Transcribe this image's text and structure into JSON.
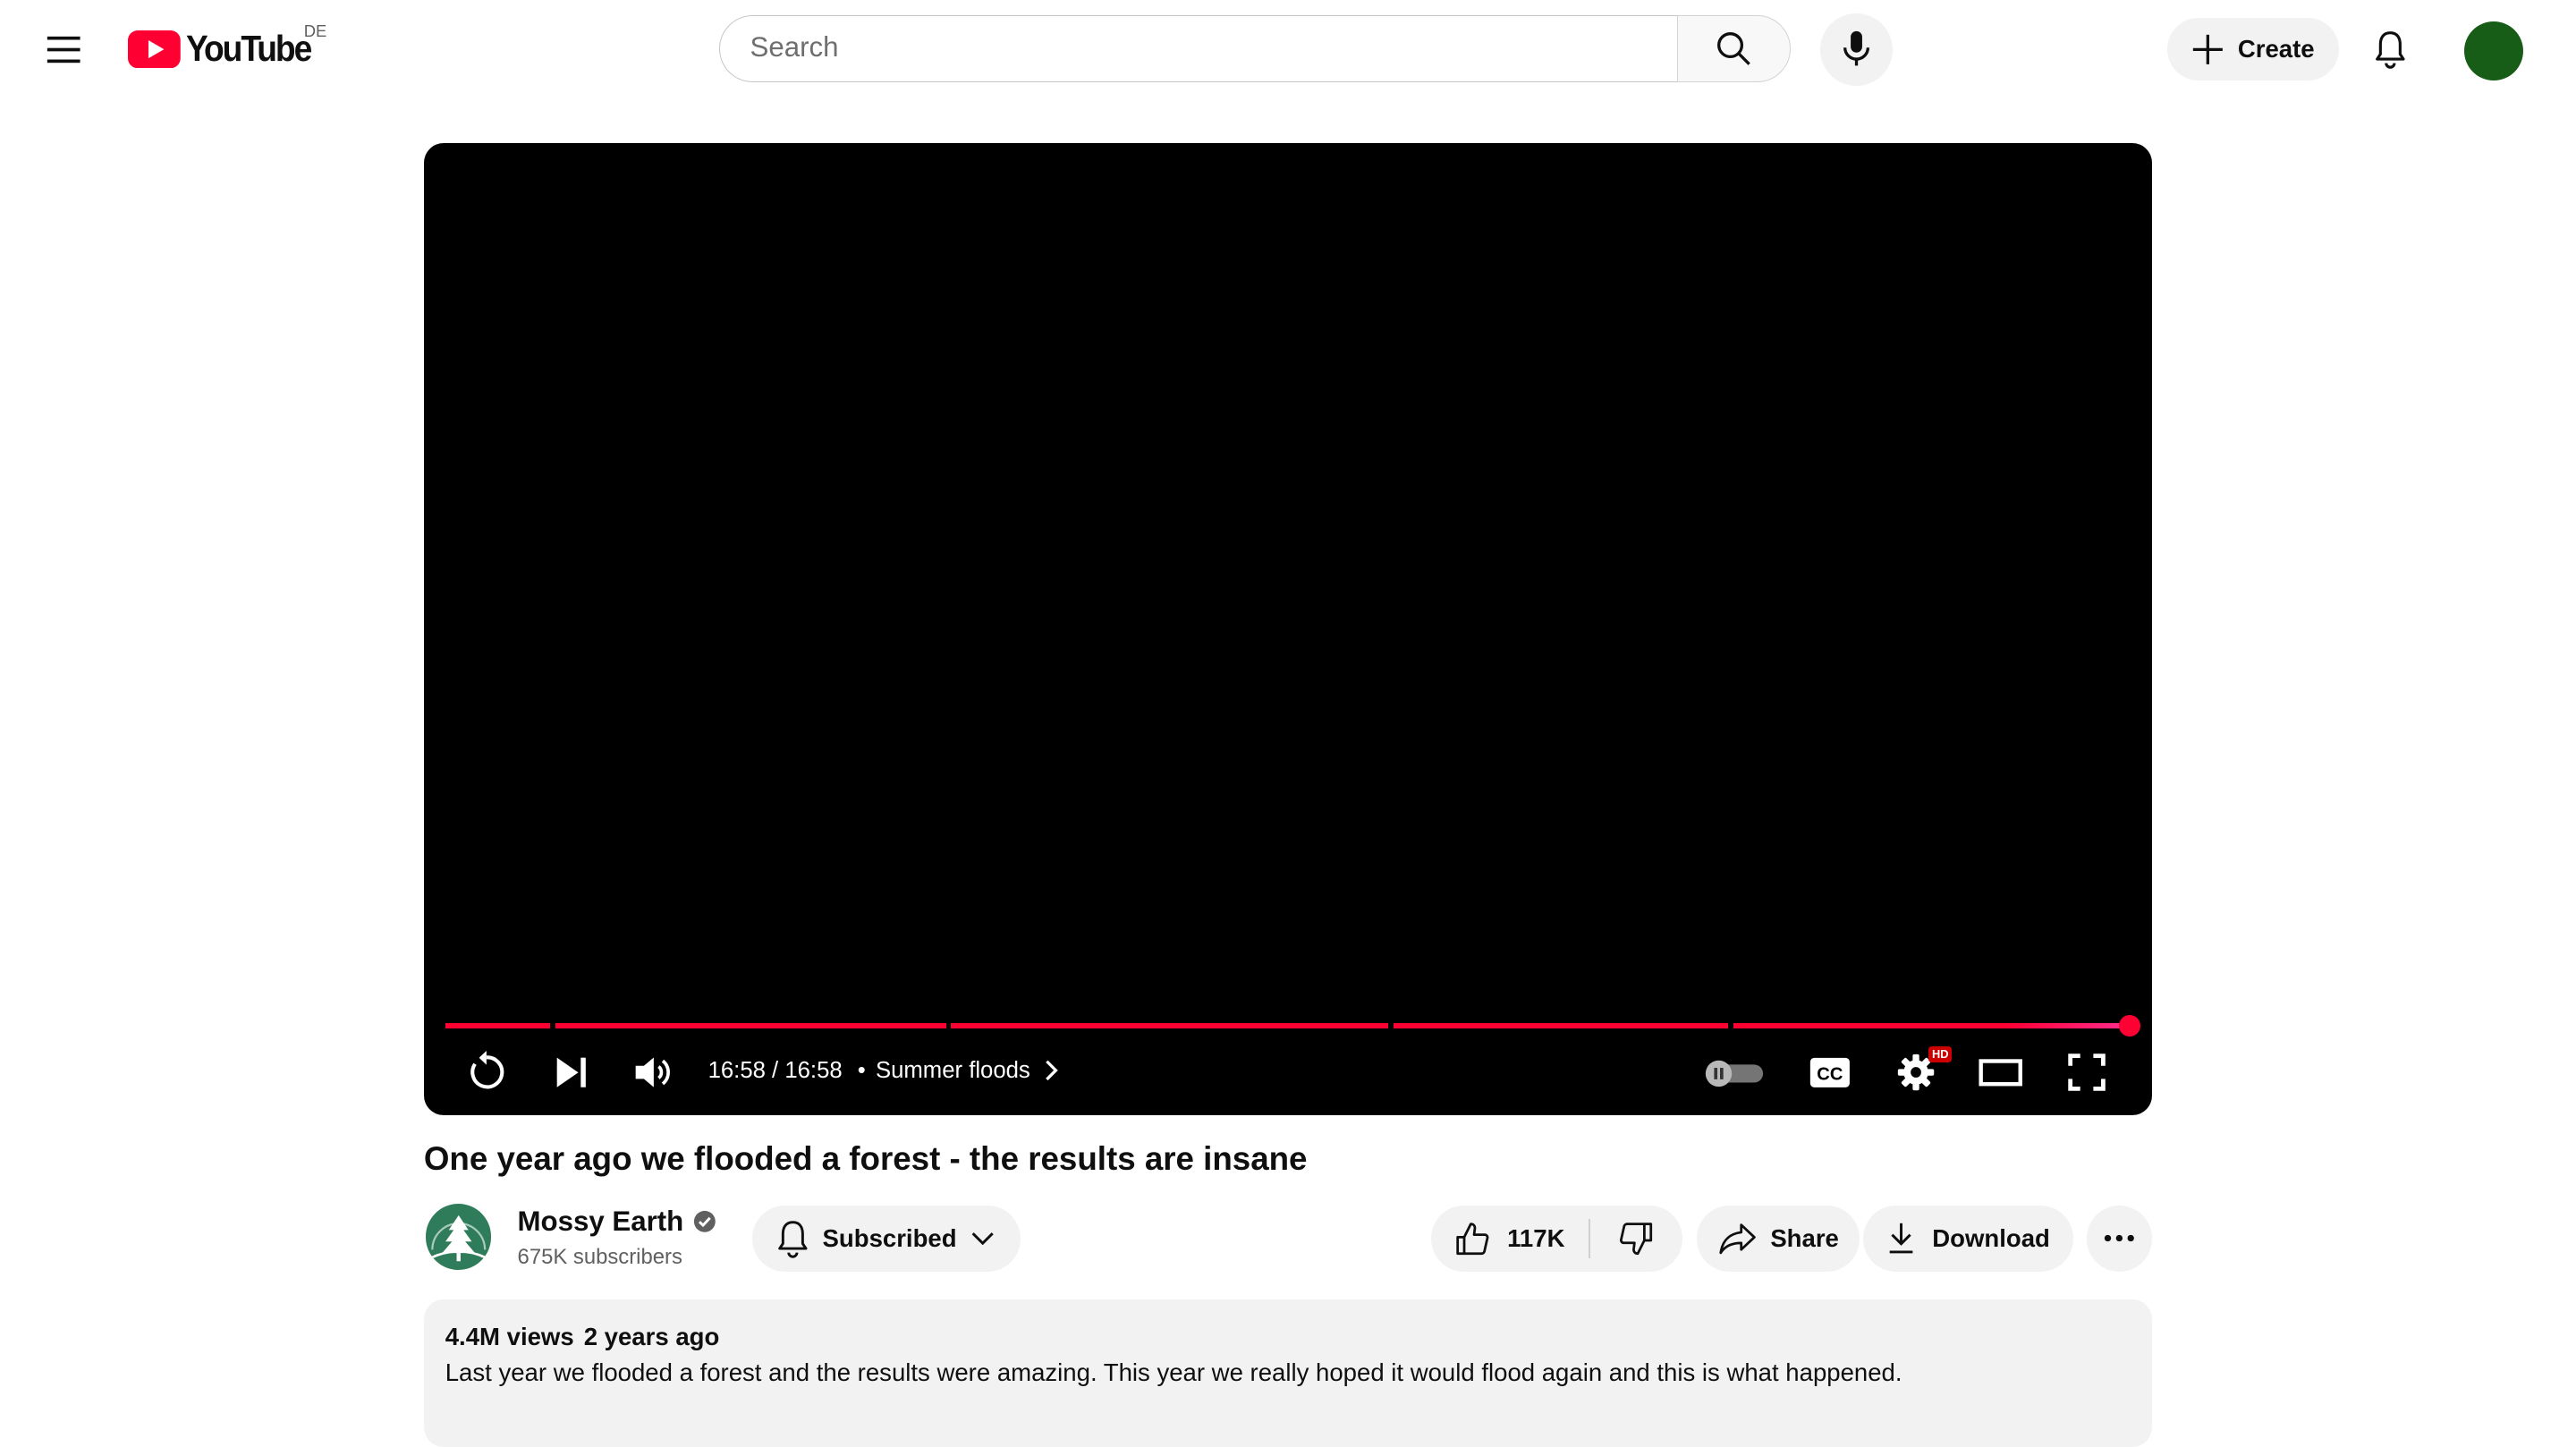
{
  "masthead": {
    "logo_text": "YouTube",
    "country_code": "DE",
    "search_placeholder": "Search",
    "create_label": "Create",
    "avatar_color": "#175c17"
  },
  "player": {
    "time": "16:58 / 16:58",
    "separator": "•",
    "chapter_title": "Summer floods",
    "progress_fraction": 1.0,
    "settings_badge": "HD",
    "accent_color": "#ff0033"
  },
  "video": {
    "title": "One year ago we flooded a forest - the results are insane",
    "channel_name": "Mossy Earth",
    "subscribers": "675K subscribers",
    "subscribe_state": "Subscribed",
    "likes": "117K",
    "share_label": "Share",
    "download_label": "Download"
  },
  "description": {
    "views": "4.4M views",
    "age": "2 years ago",
    "text": "Last year we flooded a forest and the results were amazing. This year we really hoped it would flood again and this is what happened."
  },
  "icons": [
    "menu-icon",
    "youtube-logo-icon",
    "search-icon",
    "mic-icon",
    "plus-icon",
    "bell-icon",
    "replay-icon",
    "next-icon",
    "volume-icon",
    "chevron-right-icon",
    "autoplay-toggle-icon",
    "captions-icon",
    "settings-icon",
    "theater-icon",
    "fullscreen-icon",
    "verified-icon",
    "bell-icon",
    "chevron-down-icon",
    "thumbs-up-icon",
    "thumbs-down-icon",
    "share-icon",
    "download-icon",
    "more-icon"
  ]
}
